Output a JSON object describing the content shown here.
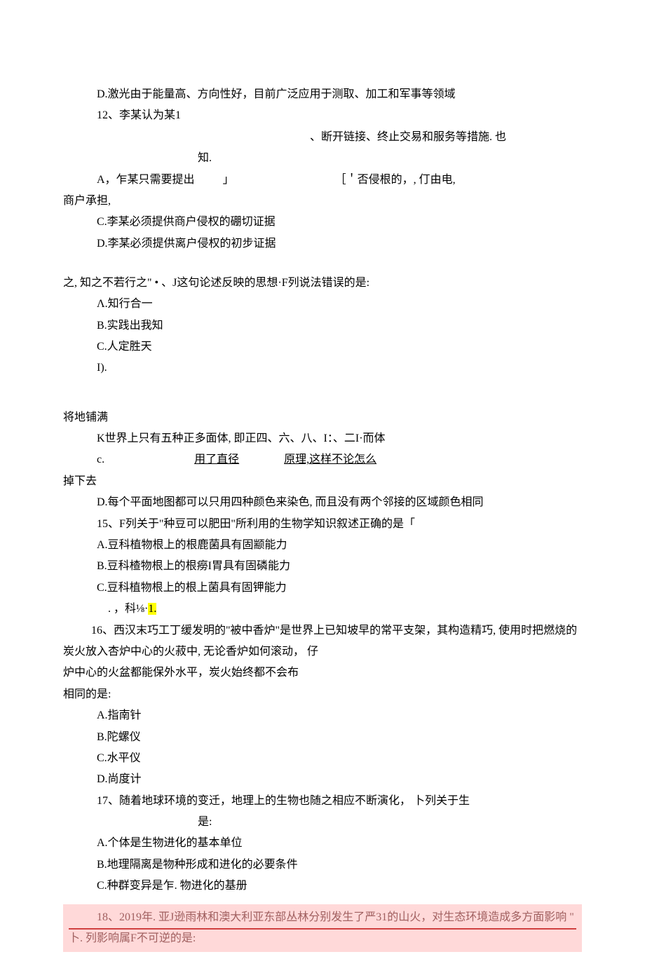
{
  "lines": {
    "l01": "D.激光由于能量高、方向性好，目前广泛应用于测取、加工和军事等领域",
    "l02": "12、李某认为某1",
    "l03": "、断开链接、终止交易和服务等措施. 也",
    "l04": "知.",
    "l05a": "A，乍某只需要提出",
    "l05b": "」",
    "l05c": "［＇否侵根的，, 仃由电,",
    "l06": "商户承担,",
    "l07": "C.李某必须提供商户侵权的硼切证据",
    "l08": "D.李某必须提供离户侵权的初步证据",
    "l09": "之, 知之不若行之\" • 、J这句论述反映的思想·F列说法错误的是:",
    "l10": "Λ.知行合一",
    "l11": "B.实践出我知",
    "l12": "C.人定胜天",
    "l13": "I).",
    "l14": "将地铺满",
    "l15": "K世界上只有五种正多面体, 即正四、六、八、I：、二I·而体",
    "l16a": "c.",
    "l16b": "用了直径",
    "l16c": "原理,这样不论怎么",
    "l17": "掉下去",
    "l18": "D.每个平面地图都可以只用四种颜色来染色, 而且没有两个邻接的区域颜色相同",
    "l19": "15、F列关于\"种豆可以肥田\"所利用的生物学知识叙述正确的是「",
    "l20": "A.豆科植物根上的根鹿菌具有固颛能力",
    "l21": "B.豆科楂物根上的根癆I胃具有固磷能力",
    "l22": "C.豆科植物根上的根上菌具有固钾能力",
    "l23a": ". ，科⅛·",
    "l23b": "1.",
    "l24": "16、西汉末巧工丁缓发明的\"被中香炉\"是世界上已知坡早的常平支架，其构造精巧, 使用时把燃烧的炭火放入杏炉中心的火菽中, 无论香炉如何滚动， 仔",
    "l25": "炉中心的火盆都能保外水平，炭火始终都不会布",
    "l26": "相同的是:",
    "l27": "A.指南针",
    "l28": "B.陀螺仪",
    "l29": "C.水平仪",
    "l30": "D.尚度计",
    "l31": "17、随着地球环境的变迁，地理上的生物也随之相应不断演化， 卜列关于生",
    "l32": "是:",
    "l33": "A.个体是生物进化的基本单位",
    "l34": "B.地理隔离是物种形成和进化的必要条件",
    "l35": "C.种群变异是乍. 物进化的基册",
    "l36": "18、2019年. 亚J逊雨林和澳大利亚东部丛林分别发生了严31的山火，对生态环境造成多方面影响 \" 卜. 列影响属F不可逆的是:"
  }
}
